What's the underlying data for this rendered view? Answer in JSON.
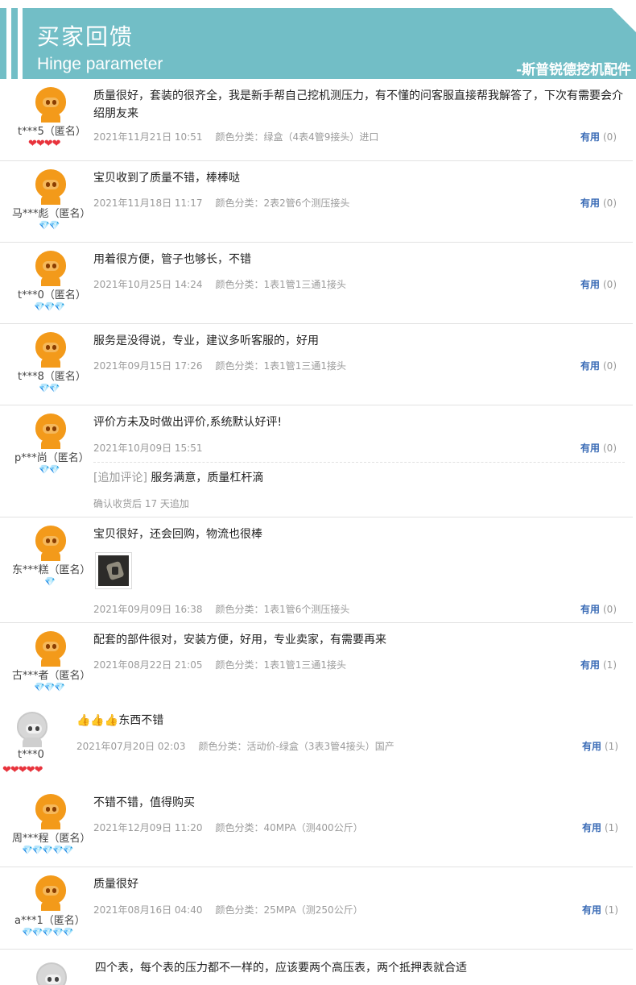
{
  "banner": {
    "title": "买家回馈",
    "subtitle": "Hinge parameter",
    "shop": "-斯普锐德挖机配件"
  },
  "useful_label": "有用",
  "reviews": [
    {
      "user": "t***5（匿名）",
      "level": "❤❤❤❤",
      "level_type": "heart",
      "avatar": "orange",
      "text": "质量很好，套装的很齐全，我是新手帮自己挖机测压力，有不懂的问客服直接帮我解答了，下次有需要会介绍朋友来",
      "date": "2021年11月21日 10:51",
      "sku": "颜色分类：绿盒（4表4管9接头）进口",
      "useful": "(0)"
    },
    {
      "user": "马***彪（匿名）",
      "level": "💎💎",
      "level_type": "gem",
      "avatar": "orange",
      "text": "宝贝收到了质量不错，棒棒哒",
      "date": "2021年11月18日 11:17",
      "sku": "颜色分类：2表2管6个测压接头",
      "useful": "(0)"
    },
    {
      "user": "t***0（匿名）",
      "level": "💎💎💎",
      "level_type": "gem",
      "avatar": "orange",
      "text": "用着很方便，管子也够长，不错",
      "date": "2021年10月25日 14:24",
      "sku": "颜色分类：1表1管1三通1接头",
      "useful": "(0)"
    },
    {
      "user": "t***8（匿名）",
      "level": "💎💎",
      "level_type": "gem",
      "avatar": "orange",
      "text": "服务是没得说，专业，建议多听客服的，好用",
      "date": "2021年09月15日 17:26",
      "sku": "颜色分类：1表1管1三通1接头",
      "useful": "(0)"
    },
    {
      "user": "p***尚（匿名）",
      "level": "💎💎",
      "level_type": "gem",
      "avatar": "orange",
      "text": "评价方未及时做出评价,系统默认好评!",
      "date": "2021年10月09日 15:51",
      "sku": "",
      "useful": "(0)",
      "append_tag": "[追加评论]",
      "append_text": "服务满意，质量杠杆滴",
      "append_note": "确认收货后 17 天追加"
    },
    {
      "user": "东***糕（匿名）",
      "level": "💎",
      "level_type": "gem",
      "avatar": "orange",
      "text": "宝贝很好，还会回购，物流也很棒",
      "date": "2021年09月09日 16:38",
      "sku": "颜色分类：1表1管6个测压接头",
      "useful": "(0)"
    },
    {
      "user": "古***者（匿名）",
      "level": "💎💎💎",
      "level_type": "gem",
      "avatar": "orange",
      "text": "配套的部件很对，安装方便，好用，专业卖家，有需要再来",
      "date": "2021年08月22日 21:05",
      "sku": "颜色分类：1表1管1三通1接头",
      "useful": "(1)"
    },
    {
      "user": "t***0",
      "level": "❤❤❤❤❤",
      "level_type": "heart",
      "avatar": "grey",
      "text_emoji": "👍👍👍",
      "text": "东西不错",
      "date": "2021年07月20日 02:03",
      "sku": "颜色分类：活动价-绿盒（3表3管4接头）国产",
      "useful": "(1)"
    },
    {
      "user": "周***程（匿名）",
      "level": "💎💎💎💎💎",
      "level_type": "gem",
      "avatar": "orange",
      "text": "不错不错，值得购买",
      "date": "2021年12月09日 11:20",
      "sku": "颜色分类：40MPA（测400公斤）",
      "useful": "(1)"
    },
    {
      "user": "a***1（匿名）",
      "level": "💎💎💎💎💎",
      "level_type": "gem",
      "avatar": "orange",
      "text": "质量很好",
      "date": "2021年08月16日 04:40",
      "sku": "颜色分类：25MPA（测250公斤）",
      "useful": "(1)"
    },
    {
      "user": "",
      "level": "",
      "level_type": "gem",
      "avatar": "grey",
      "text": "四个表，每个表的压力都不一样的，应该要两个高压表，两个抵押表就合适",
      "date": "",
      "sku": "",
      "useful": ""
    }
  ]
}
